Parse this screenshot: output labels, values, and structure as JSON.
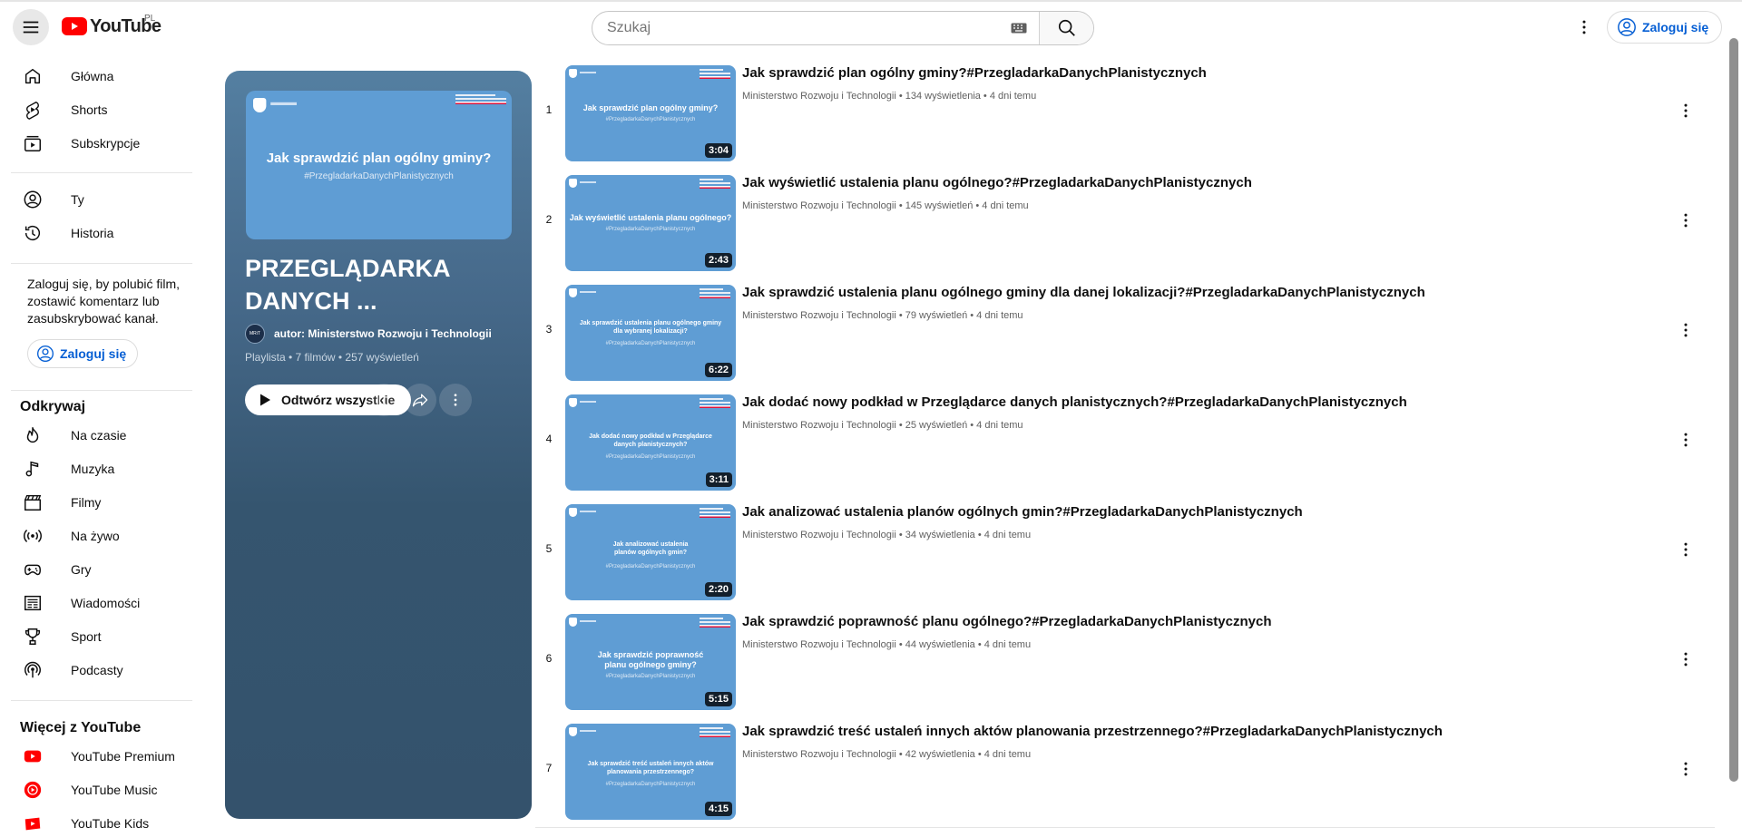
{
  "header": {
    "logo_text": "YouTube",
    "country": "PL",
    "search_placeholder": "Szukaj",
    "signin_label": "Zaloguj się"
  },
  "sidebar": {
    "main": [
      "Główna",
      "Shorts",
      "Subskrypcje"
    ],
    "you": [
      "Ty",
      "Historia"
    ],
    "signin_prompt": "Zaloguj się, by polubić film, zostawić komentarz lub zasubskrybować kanał.",
    "signin_label": "Zaloguj się",
    "explore_title": "Odkrywaj",
    "explore": [
      "Na czasie",
      "Muzyka",
      "Filmy",
      "Na żywo",
      "Gry",
      "Wiadomości",
      "Sport",
      "Podcasty"
    ],
    "more_title": "Więcej z YouTube",
    "more": [
      "YouTube Premium",
      "YouTube Music",
      "YouTube Kids"
    ]
  },
  "playlist": {
    "thumb_title": "Jak sprawdzić plan ogólny gminy?",
    "thumb_tag": "#PrzegladarkaDanychPlanistycznych",
    "title": "PRZEGLĄDARKA DANYCH ...",
    "author": "autor: Ministerstwo Rozwoju i Technologii",
    "meta": "Playlista • 7 filmów • 257 wyświetleń",
    "play_all": "Odtwórz wszystkie"
  },
  "videos": [
    {
      "index": "1",
      "title": "Jak sprawdzić plan ogólny gminy?#PrzegladarkaDanychPlanistycznych",
      "meta": "Ministerstwo Rozwoju i Technologii • 134 wyświetlenia • 4 dni temu",
      "duration": "3:04",
      "thumb_title": "Jak sprawdzić plan ogólny gminy?",
      "thumb_tag": "#PrzegladarkaDanychPlanistycznych"
    },
    {
      "index": "2",
      "title": "Jak wyświetlić ustalenia planu ogólnego?#PrzegladarkaDanychPlanistycznych",
      "meta": "Ministerstwo Rozwoju i Technologii • 145 wyświetleń • 4 dni temu",
      "duration": "2:43",
      "thumb_title": "Jak wyświetlić ustalenia planu ogólnego?",
      "thumb_tag": "#PrzegladarkaDanychPlanistycznych"
    },
    {
      "index": "3",
      "title": "Jak sprawdzić ustalenia planu ogólnego gminy dla danej lokalizacji?#PrzegladarkaDanychPlanistycznych",
      "meta": "Ministerstwo Rozwoju i Technologii • 79 wyświetleń • 4 dni temu",
      "duration": "6:22",
      "thumb_title": "Jak sprawdzić ustalenia planu ogólnego gminy dla wybranej lokalizacji?",
      "thumb_tag": "#PrzegladarkaDanychPlanistycznych"
    },
    {
      "index": "4",
      "title": "Jak dodać nowy podkład w Przeglądarce danych planistycznych?#PrzegladarkaDanychPlanistycznych",
      "meta": "Ministerstwo Rozwoju i Technologii • 25 wyświetleń • 4 dni temu",
      "duration": "3:11",
      "thumb_title": "Jak dodać nowy podkład w Przeglądarce danych planistycznych?",
      "thumb_tag": "#PrzegladarkaDanychPlanistycznych"
    },
    {
      "index": "5",
      "title": "Jak analizować ustalenia planów ogólnych gmin?#PrzegladarkaDanychPlanistycznych",
      "meta": "Ministerstwo Rozwoju i Technologii • 34 wyświetlenia • 4 dni temu",
      "duration": "2:20",
      "thumb_title": "Jak analizować ustalenia planów ogólnych gmin?",
      "thumb_tag": "#PrzegladarkaDanychPlanistycznych"
    },
    {
      "index": "6",
      "title": "Jak sprawdzić poprawność planu ogólnego?#PrzegladarkaDanychPlanistycznych",
      "meta": "Ministerstwo Rozwoju i Technologii • 44 wyświetlenia • 4 dni temu",
      "duration": "5:15",
      "thumb_title": "Jak sprawdzić poprawność planu ogólnego gminy?",
      "thumb_tag": "#PrzegladarkaDanychPlanistycznych"
    },
    {
      "index": "7",
      "title": "Jak sprawdzić treść ustaleń innych aktów planowania przestrzennego?#PrzegladarkaDanychPlanistycznych",
      "meta": "Ministerstwo Rozwoju i Technologii • 42 wyświetlenia • 4 dni temu",
      "duration": "4:15",
      "thumb_title": "Jak sprawdzić treść ustaleń innych aktów planowania przestrzennego?",
      "thumb_tag": "#PrzegladarkaDanychPlanistycznych"
    }
  ],
  "colors": {
    "accent": "#065fd4",
    "brand_red": "#ff0000",
    "panel_bg": "#3b5d7a",
    "thumb_bg": "#5f9dd4"
  }
}
